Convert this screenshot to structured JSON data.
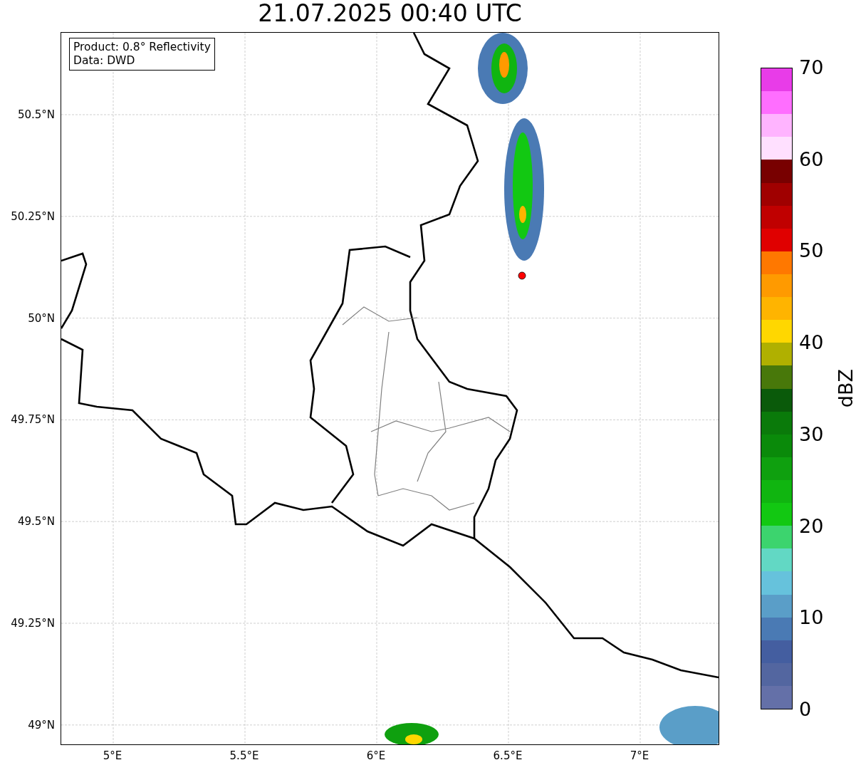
{
  "title": "21.07.2025 00:40 UTC",
  "info_box": [
    "Product: 0.8° Reflectivity",
    "Data: DWD"
  ],
  "map": {
    "yticks": [
      "50.5°N",
      "50.25°N",
      "50°N",
      "49.75°N",
      "49.5°N",
      "49.25°N",
      "49°N"
    ],
    "xticks": [
      "5°E",
      "5.5°E",
      "6°E",
      "6.5°E",
      "7°E"
    ]
  },
  "colorbar": {
    "label": "dBZ",
    "ticks": [
      "70",
      "60",
      "50",
      "40",
      "30",
      "20",
      "10",
      "0"
    ],
    "segments": [
      {
        "color": "#e83ce8"
      },
      {
        "color": "#ff6eff"
      },
      {
        "color": "#ffb4ff"
      },
      {
        "color": "#ffe0ff"
      },
      {
        "color": "#780000"
      },
      {
        "color": "#a00000"
      },
      {
        "color": "#c00000"
      },
      {
        "color": "#e00000"
      },
      {
        "color": "#ff7800"
      },
      {
        "color": "#ff9a00"
      },
      {
        "color": "#ffb400"
      },
      {
        "color": "#ffd700"
      },
      {
        "color": "#b0b000"
      },
      {
        "color": "#48780a"
      },
      {
        "color": "#0a5a0a"
      },
      {
        "color": "#0a7a0a"
      },
      {
        "color": "#0a8a0a"
      },
      {
        "color": "#0fa00f"
      },
      {
        "color": "#10b510"
      },
      {
        "color": "#12c812"
      },
      {
        "color": "#3cd46e"
      },
      {
        "color": "#62d8c4"
      },
      {
        "color": "#66c2dc"
      },
      {
        "color": "#5a9ec8"
      },
      {
        "color": "#4a7ab4"
      },
      {
        "color": "#445ea0"
      },
      {
        "color": "#5366a0"
      },
      {
        "color": "#6470a8"
      }
    ]
  }
}
